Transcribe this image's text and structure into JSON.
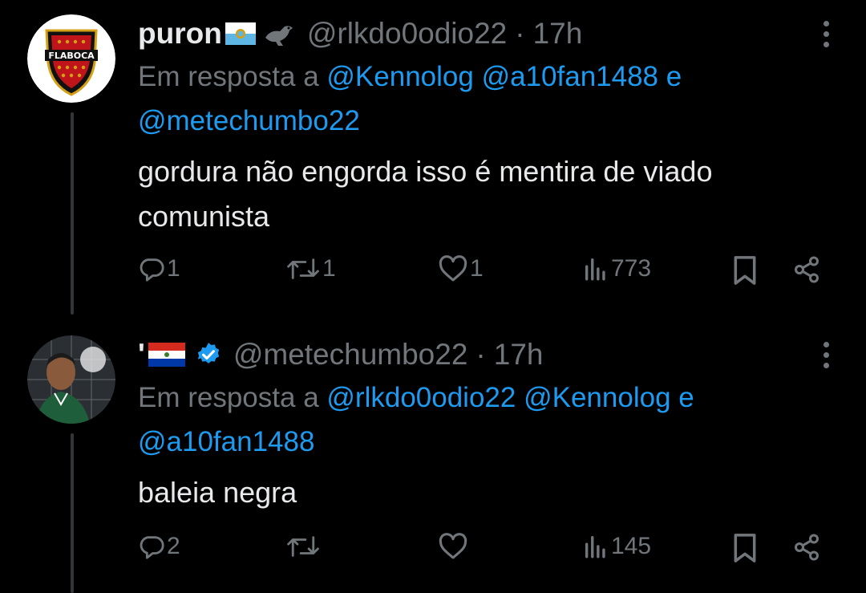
{
  "colors": {
    "background": "#000000",
    "text": "#e7e9ea",
    "muted": "#71767b",
    "link": "#1d9bf0",
    "verified": "#1d9bf0"
  },
  "tweets": [
    {
      "display_name": "puron",
      "name_emojis": [
        "flag-san-marino",
        "bird-icon"
      ],
      "handle": "@rlkdo0odio22",
      "time": "17h",
      "avatar_text": "FLABOCA",
      "reply_prefix": "Em resposta a",
      "reply_mentions": [
        "@Kennolog",
        "@a10fan1488"
      ],
      "reply_joiner": "e",
      "reply_last": "@metechumbo22",
      "text_line1": "gordura não engorda isso é mentira de viado",
      "text_line2": "comunista",
      "replies": "1",
      "retweets": "1",
      "likes": "1",
      "views": "773"
    },
    {
      "display_name": "'",
      "name_emojis": [
        "flag-paraguay",
        "verified-badge-icon"
      ],
      "handle": "@metechumbo22",
      "time": "17h",
      "reply_prefix": "Em resposta a",
      "reply_mentions": [
        "@rlkdo0odio22",
        "@Kennolog"
      ],
      "reply_joiner": "e",
      "reply_last": "@a10fan1488",
      "text_line1": "baleia negra",
      "replies": "2",
      "retweets": "",
      "likes": "",
      "views": "145"
    }
  ]
}
